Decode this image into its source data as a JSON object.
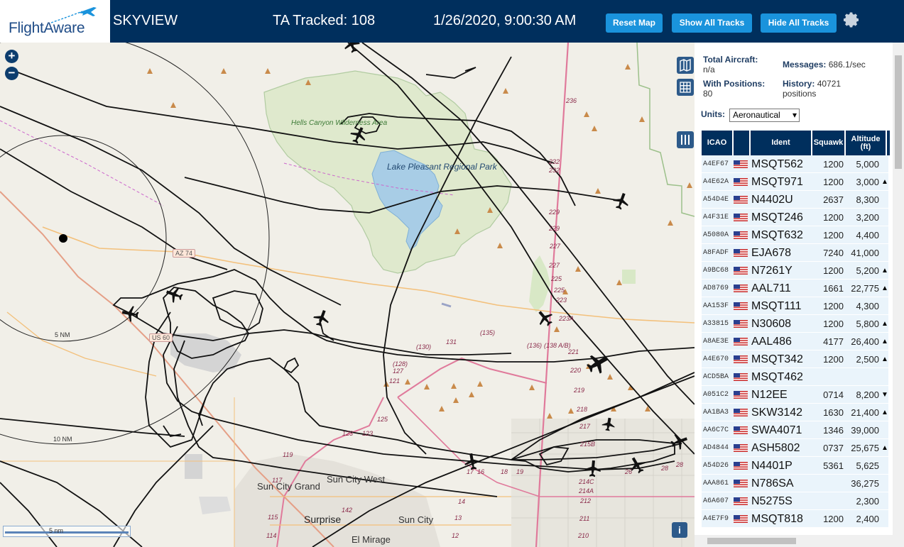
{
  "header": {
    "logo_text": "FlightAware",
    "app_title": "SKYVIEW",
    "tracked": "TA Tracked: 108",
    "datetime": "1/26/2020, 9:00:30 AM",
    "buttons": {
      "reset": "Reset Map",
      "show": "Show All Tracks",
      "hide": "Hide All Tracks"
    }
  },
  "map": {
    "zoom_in": "+",
    "zoom_out": "−",
    "labels": {
      "hells_canyon": "Hells Canyon Wilderness Area",
      "lake_pleasant": "Lake Pleasant Regional Park",
      "az74": "AZ 74",
      "us60": "US 60",
      "ring5": "5 NM",
      "ring10": "10 NM",
      "sun_city_grand": "Sun City Grand",
      "sun_city_west": "Sun City West",
      "sun_city": "Sun City",
      "surprise": "Surprise",
      "el_mirage": "El Mirage",
      "scale": "5 nm",
      "info": "i"
    },
    "road_numbers": [
      "236",
      "232",
      "232",
      "229",
      "229",
      "227",
      "227",
      "225",
      "225",
      "223",
      "223A",
      "221",
      "220",
      "219",
      "218",
      "217",
      "215B",
      "214C",
      "214A",
      "212",
      "211",
      "210",
      "(135)",
      "(130)",
      "131",
      "(136)",
      "(138 A/B)",
      "(128)",
      "127",
      "121",
      "125",
      "123",
      "123",
      "119",
      "117",
      "115",
      "114",
      "142",
      "14",
      "13",
      "12",
      "17",
      "16",
      "18",
      "19",
      "28",
      "28",
      "26"
    ]
  },
  "sidebar": {
    "total_aircraft_label": "Total Aircraft:",
    "total_aircraft_value": "n/a",
    "with_positions_label": "With Positions:",
    "with_positions_value": "80",
    "messages_label": "Messages:",
    "messages_value": "686.1/sec",
    "history_label": "History:",
    "history_value": "40721 positions",
    "units_label": "Units:",
    "units_value": "Aeronautical",
    "columns": {
      "icao": "ICAO",
      "ident": "Ident",
      "squawk": "Squawk",
      "altitude": "Altitude (ft)"
    },
    "rows": [
      {
        "icao": "A4EF67",
        "ident": "MSQT562",
        "squawk": "1200",
        "alt": "5,000",
        "trend": ""
      },
      {
        "icao": "A4E62A",
        "ident": "MSQT971",
        "squawk": "1200",
        "alt": "3,000",
        "trend": "▲"
      },
      {
        "icao": "A54D4E",
        "ident": "N4402U",
        "squawk": "2637",
        "alt": "8,300",
        "trend": ""
      },
      {
        "icao": "A4F31E",
        "ident": "MSQT246",
        "squawk": "1200",
        "alt": "3,200",
        "trend": ""
      },
      {
        "icao": "A5080A",
        "ident": "MSQT632",
        "squawk": "1200",
        "alt": "4,400",
        "trend": ""
      },
      {
        "icao": "A8FADF",
        "ident": "EJA678",
        "squawk": "7240",
        "alt": "41,000",
        "trend": ""
      },
      {
        "icao": "A9BC68",
        "ident": "N7261Y",
        "squawk": "1200",
        "alt": "5,200",
        "trend": "▲"
      },
      {
        "icao": "AD8769",
        "ident": "AAL711",
        "squawk": "1661",
        "alt": "22,775",
        "trend": "▲"
      },
      {
        "icao": "AA153F",
        "ident": "MSQT111",
        "squawk": "1200",
        "alt": "4,300",
        "trend": ""
      },
      {
        "icao": "A33815",
        "ident": "N30608",
        "squawk": "1200",
        "alt": "5,800",
        "trend": "▲"
      },
      {
        "icao": "A8AE3E",
        "ident": "AAL486",
        "squawk": "4177",
        "alt": "26,400",
        "trend": "▲"
      },
      {
        "icao": "A4E670",
        "ident": "MSQT342",
        "squawk": "1200",
        "alt": "2,500",
        "trend": "▲"
      },
      {
        "icao": "ACD5BA",
        "ident": "MSQT462",
        "squawk": "",
        "alt": "",
        "trend": ""
      },
      {
        "icao": "A051C2",
        "ident": "N12EE",
        "squawk": "0714",
        "alt": "8,200",
        "trend": "▼"
      },
      {
        "icao": "AA1BA3",
        "ident": "SKW3142",
        "squawk": "1630",
        "alt": "21,400",
        "trend": "▲"
      },
      {
        "icao": "AA6C7C",
        "ident": "SWA4071",
        "squawk": "1346",
        "alt": "39,000",
        "trend": ""
      },
      {
        "icao": "AD4844",
        "ident": "ASH5802",
        "squawk": "0737",
        "alt": "25,675",
        "trend": "▲"
      },
      {
        "icao": "A54D26",
        "ident": "N4401P",
        "squawk": "5361",
        "alt": "5,625",
        "trend": ""
      },
      {
        "icao": "AAA861",
        "ident": "N786SA",
        "squawk": "",
        "alt": "36,275",
        "trend": ""
      },
      {
        "icao": "A6A607",
        "ident": "N5275S",
        "squawk": "",
        "alt": "2,300",
        "trend": ""
      },
      {
        "icao": "A4E7F9",
        "ident": "MSQT818",
        "squawk": "1200",
        "alt": "2,400",
        "trend": ""
      }
    ]
  },
  "colors": {
    "header_bg": "#002f5d",
    "button_bg": "#1a93dc",
    "map_bg": "#f1efe8",
    "row_bg": "#eaf4fb",
    "track": "#111111"
  }
}
